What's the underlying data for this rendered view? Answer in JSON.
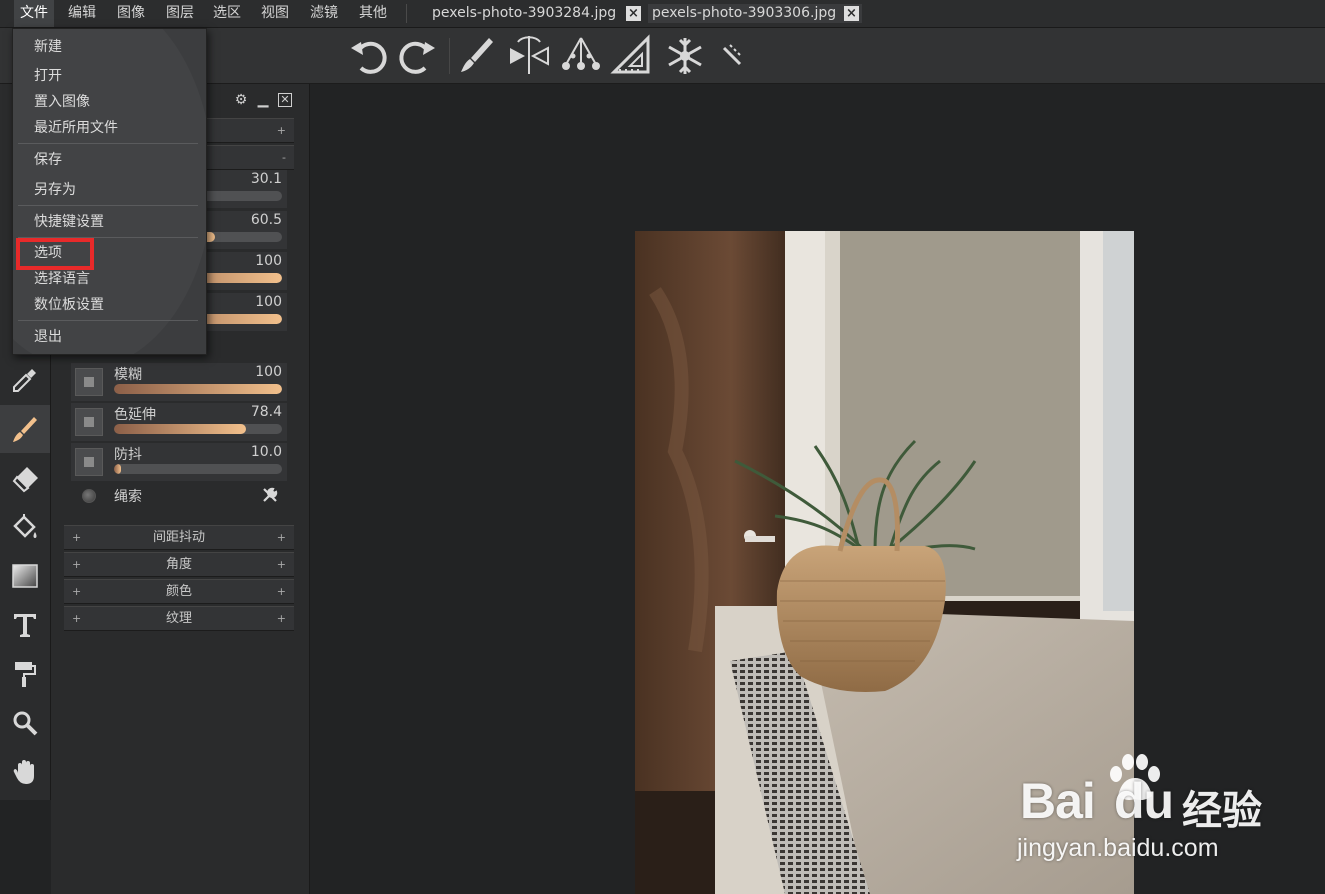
{
  "menubar": {
    "items": [
      "文件",
      "编辑",
      "图像",
      "图层",
      "选区",
      "视图",
      "滤镜",
      "其他"
    ],
    "active_index": 0
  },
  "tabs": [
    {
      "label": "pexels-photo-3903284.jpg",
      "active": false
    },
    {
      "label": "pexels-photo-3903306.jpg",
      "active": true
    }
  ],
  "toolbar": {
    "icons": [
      "undo-icon",
      "redo-icon",
      "brush-icon",
      "symmetry-icon",
      "scatter-icon",
      "ruler-triangle-icon",
      "snowflake-icon",
      "stamp-icon"
    ]
  },
  "tools": [
    "eyedropper-icon",
    "brush-icon",
    "eraser-icon",
    "fill-bucket-icon",
    "gradient-icon",
    "text-icon",
    "paint-roller-icon",
    "zoom-icon",
    "hand-icon"
  ],
  "file_menu": {
    "items": [
      {
        "label": "新建"
      },
      {
        "label": "打开"
      },
      {
        "label": "置入图像"
      },
      {
        "label": "最近所用文件"
      },
      {
        "label": "保存"
      },
      {
        "label": "另存为"
      },
      {
        "label": "快捷键设置"
      },
      {
        "label": "选项",
        "highlighted": true
      },
      {
        "label": "选择语言"
      },
      {
        "label": "数位板设置"
      },
      {
        "label": "退出"
      }
    ]
  },
  "brush_panel": {
    "section_toggles": [
      "+",
      "-"
    ],
    "hidden_values": [
      "30.1",
      "60.5",
      "100",
      "100"
    ],
    "hidden_fills": [
      0,
      0.6,
      1.0,
      1.0
    ],
    "params": [
      {
        "label": "模糊",
        "value": "100",
        "fill": 1.0
      },
      {
        "label": "色延伸",
        "value": "78.4",
        "fill": 0.784
      },
      {
        "label": "防抖",
        "value": "10.0",
        "fill": 0.04
      }
    ],
    "lasso_label": "绳索",
    "sections": [
      "间距抖动",
      "角度",
      "颜色",
      "纹理"
    ]
  },
  "watermark": {
    "brand": "Bai",
    "brand_tail": "du",
    "brand_cn": "经验",
    "url": "jingyan.baidu.com"
  }
}
